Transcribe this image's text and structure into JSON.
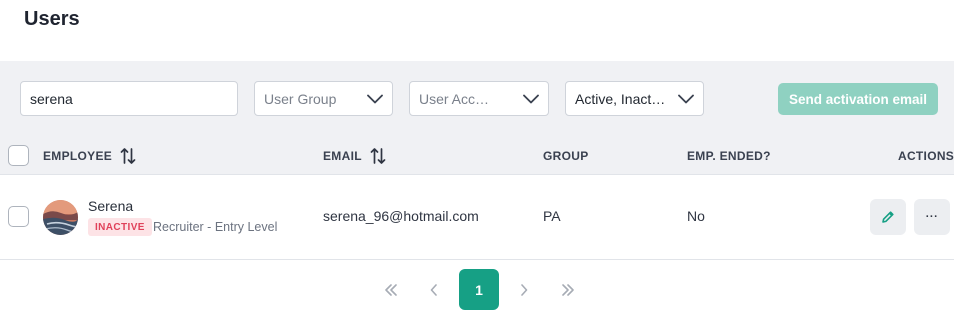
{
  "page": {
    "title": "Users"
  },
  "filters": {
    "search": {
      "value": "serena"
    },
    "user_group": {
      "placeholder": "User Group"
    },
    "user_access": {
      "placeholder": "User Acc…"
    },
    "status": {
      "value": "Active, Inact…"
    },
    "send_activation_label": "Send activation email"
  },
  "table": {
    "columns": {
      "employee": "EMPLOYEE",
      "email": "EMAIL",
      "group": "GROUP",
      "emp_ended": "EMP. ENDED?",
      "actions": "ACTIONS"
    },
    "rows": [
      {
        "name": "Serena",
        "status_badge": "INACTIVE",
        "job_title": "Recruiter - Entry Level",
        "email": "serena_96@hotmail.com",
        "group": "PA",
        "emp_ended": "No",
        "more_label": "···"
      }
    ]
  },
  "pagination": {
    "current_page": "1"
  },
  "colors": {
    "accent": "#16a085",
    "accent_disabled": "#8fd1c1",
    "inactive_badge_bg": "#fde3e6",
    "inactive_badge_text": "#e0415a"
  },
  "icons": [
    "chevron-down-icon",
    "sort-icon",
    "pencil-icon",
    "more-icon",
    "double-chevron-left-icon",
    "chevron-left-icon",
    "chevron-right-icon",
    "double-chevron-right-icon"
  ]
}
